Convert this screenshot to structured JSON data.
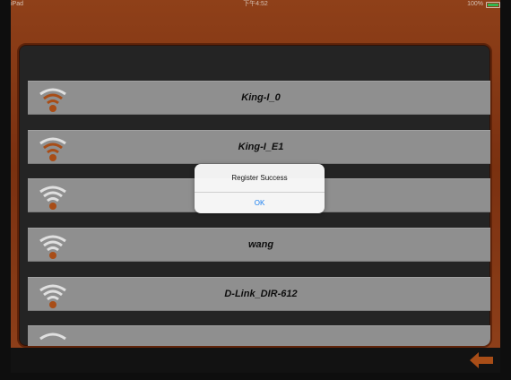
{
  "status_bar": {
    "carrier": "iPad",
    "time": "下午4:52",
    "battery": "100%"
  },
  "wifi_list": [
    {
      "ssid": "King-I_0",
      "signal_color": "#c0581b"
    },
    {
      "ssid": "King-I_E1",
      "signal_color": "#c0581b"
    },
    {
      "ssid": "",
      "signal_color": "#c0581b"
    },
    {
      "ssid": "wang",
      "signal_color": "#c0581b"
    },
    {
      "ssid": "D-Link_DIR-612",
      "signal_color": "#c0581b"
    },
    {
      "ssid": "",
      "signal_color": "#c0581b"
    }
  ],
  "alert": {
    "message": "Register Success",
    "button": "OK"
  },
  "colors": {
    "frame": "#9a4219",
    "row": "#a3a3a3",
    "accent": "#c0581b",
    "link": "#1a7ff0"
  },
  "icons": {
    "wifi": "wifi-signal-icon",
    "back": "back-arrow-icon"
  }
}
